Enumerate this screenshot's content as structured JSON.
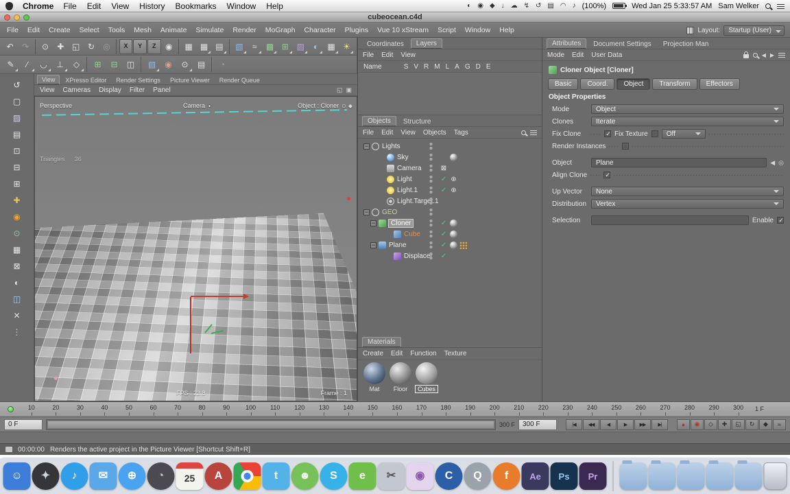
{
  "mac": {
    "app_name": "Chrome",
    "menus": [
      "File",
      "Edit",
      "View",
      "History",
      "Bookmarks",
      "Window",
      "Help"
    ],
    "status_icons": [
      {
        "name": "menu-extra-display-icon",
        "g": "◐"
      },
      {
        "name": "menu-extra-capture-icon",
        "g": "◉"
      },
      {
        "name": "menu-extra-dropbox-icon",
        "g": "◆"
      },
      {
        "name": "menu-extra-download-icon",
        "g": "↓"
      },
      {
        "name": "menu-extra-cloud-icon",
        "g": "☁"
      },
      {
        "name": "menu-extra-power-icon",
        "g": "↯"
      },
      {
        "name": "menu-extra-timemachine-icon",
        "g": "↺"
      },
      {
        "name": "menu-extra-airplay-icon",
        "g": "▤"
      },
      {
        "name": "menu-extra-wifi-icon",
        "g": "◠"
      },
      {
        "name": "menu-extra-volume-icon",
        "g": "♪"
      }
    ],
    "battery_pct": "(100%)",
    "clock": "Wed Jan 25  5:33:57 AM",
    "user": "Sam Welker"
  },
  "window_title": "cubeocean.c4d",
  "menu": {
    "items": [
      "File",
      "Edit",
      "Create",
      "Select",
      "Tools",
      "Mesh",
      "Animate",
      "Simulate",
      "Render",
      "MoGraph",
      "Character",
      "Plugins",
      "Vue 10 xStream",
      "Script",
      "Window",
      "Help"
    ],
    "layout_label": "Layout:",
    "layout_value": "Startup (User)"
  },
  "toolbar1": [
    {
      "name": "undo-icon",
      "g": "↶"
    },
    {
      "name": "redo-icon",
      "g": "↷",
      "cls": "dim"
    },
    {
      "name": "toolbar-separator",
      "cls": "sep",
      "inter": false
    },
    {
      "name": "live-selection-icon",
      "g": "⊙"
    },
    {
      "name": "move-tool-icon",
      "g": "✚"
    },
    {
      "name": "scale-tool-icon",
      "g": "◱"
    },
    {
      "name": "rotate-tool-icon",
      "g": "↻"
    },
    {
      "name": "last-tool-icon",
      "g": "◎",
      "cls": "dim"
    },
    {
      "name": "toolbar-separator",
      "cls": "sep",
      "inter": false
    },
    {
      "name": "lock-x-axis-button",
      "g": "X",
      "cls": "axis"
    },
    {
      "name": "lock-y-axis-button",
      "g": "Y",
      "cls": "axis"
    },
    {
      "name": "lock-z-axis-button",
      "g": "Z",
      "cls": "axis"
    },
    {
      "name": "coordinate-system-icon",
      "g": "◉"
    },
    {
      "name": "toolbar-separator",
      "cls": "sep",
      "inter": false
    },
    {
      "name": "render-active-view-icon",
      "g": "▦"
    },
    {
      "name": "render-picture-viewer-icon",
      "g": "▦",
      "cls": "arr"
    },
    {
      "name": "render-settings-icon",
      "g": "▤",
      "cls": "arr"
    },
    {
      "name": "toolbar-separator",
      "cls": "sep",
      "inter": false
    },
    {
      "name": "primitive-cube-icon",
      "g": "▧",
      "c": "#8db8e8",
      "cls": "arr"
    },
    {
      "name": "spline-pen-icon",
      "g": "≈",
      "cls": "arr"
    },
    {
      "name": "generators-icon",
      "g": "▩",
      "c": "#8fd08f",
      "cls": "arr"
    },
    {
      "name": "mograph-array-icon",
      "g": "⊞",
      "c": "#8fd08f",
      "cls": "arr"
    },
    {
      "name": "deformers-icon",
      "g": "▨",
      "c": "#bb9ddb",
      "cls": "arr"
    },
    {
      "name": "environment-icon",
      "g": "◐",
      "c": "#9ecbf0",
      "cls": "arr"
    },
    {
      "name": "camera-add-icon",
      "g": "▦",
      "cls": "arr"
    },
    {
      "name": "light-add-icon",
      "g": "☀",
      "c": "#f2df7a",
      "cls": "arr"
    }
  ],
  "toolbar2": [
    {
      "name": "brush-tool-icon",
      "g": "✎",
      "cls": "arr"
    },
    {
      "name": "knife-tool-icon",
      "g": "∕",
      "cls": "arr"
    },
    {
      "name": "magnet-tool-icon",
      "g": "◡",
      "cls": "arr"
    },
    {
      "name": "extrude-tool-icon",
      "g": "⊥",
      "cls": "arr"
    },
    {
      "name": "bevel-tool-icon",
      "g": "◇",
      "cls": "arr"
    },
    {
      "name": "toolbar-separator",
      "cls": "sep",
      "inter": false
    },
    {
      "name": "subdivide-icon",
      "g": "⊞",
      "c": "#8fd08f"
    },
    {
      "name": "optimize-icon",
      "g": "⊟",
      "c": "#8fd08f"
    },
    {
      "name": "mirror-icon",
      "g": "◫"
    },
    {
      "name": "toolbar-separator",
      "cls": "sep",
      "inter": false
    },
    {
      "name": "add-cube-icon",
      "g": "▧",
      "c": "#8db8e8",
      "cls": "arr"
    },
    {
      "name": "add-material-icon",
      "g": "◉",
      "c": "#e09a8a"
    },
    {
      "name": "snap-settings-icon",
      "g": "⊙",
      "cls": "arr"
    },
    {
      "name": "workplane-icon",
      "g": "▤"
    },
    {
      "name": "toolbar-separator",
      "cls": "sep",
      "inter": false
    },
    {
      "name": "isoline-editing-icon",
      "g": "◔",
      "cls": "dim"
    }
  ],
  "left_tools": [
    {
      "name": "make-editable-icon",
      "g": "↺",
      "c": "#e8e8e8"
    },
    {
      "name": "model-mode-icon",
      "g": "▢",
      "c": "#e8e8e8"
    },
    {
      "name": "texture-mode-icon",
      "g": "▨",
      "c": "#cfcfe8"
    },
    {
      "name": "workplane-mode-icon",
      "g": "▤",
      "c": "#e8e8e8"
    },
    {
      "name": "points-mode-icon",
      "g": "⊡",
      "c": "#e8e8e8"
    },
    {
      "name": "edges-mode-icon",
      "g": "⊟",
      "c": "#e8e8e8"
    },
    {
      "name": "polygons-mode-icon",
      "g": "⊞",
      "c": "#e8e8e8"
    },
    {
      "name": "enable-axis-icon",
      "g": "✚",
      "c": "#e8c85a"
    },
    {
      "name": "viewport-solo-icon",
      "g": "◉",
      "c": "#e8a33c"
    },
    {
      "name": "snap-toggle-icon",
      "g": "⊙",
      "c": "#8fd08f"
    },
    {
      "name": "quantize-icon",
      "g": "▦",
      "c": "#e8e8e8"
    },
    {
      "name": "lock-workplane-icon",
      "g": "⊠",
      "c": "#e8e8e8"
    },
    {
      "name": "xray-toggle-icon",
      "g": "◐",
      "c": "#e8e8e8"
    },
    {
      "name": "isoline-icon",
      "g": "◫",
      "c": "#9ecbf0"
    },
    {
      "name": "close-tool-icon",
      "g": "✕",
      "c": "#e0e0e0"
    },
    {
      "name": "palette-handle-icon",
      "g": "⋮",
      "c": "#cfcfcf"
    }
  ],
  "viewport": {
    "window_tabs": [
      {
        "label": "View",
        "cls": "on"
      },
      {
        "label": "XPresso Editor"
      },
      {
        "label": "Render Settings"
      },
      {
        "label": "Picture Viewer"
      },
      {
        "label": "Render Queue"
      }
    ],
    "menus": [
      "View",
      "Cameras",
      "Display",
      "Filter",
      "Panel"
    ],
    "corner_icons": [
      {
        "name": "viewport-undock-icon",
        "g": "◱"
      },
      {
        "name": "viewport-maximize-icon",
        "g": "▣"
      }
    ],
    "view_label": "Perspective",
    "camera_label": "Camera",
    "object_label": "Object : Cloner",
    "object_icons": [
      {
        "name": "viewport-lock-icon",
        "g": "⊙"
      },
      {
        "name": "viewport-key-icon",
        "g": "◆"
      }
    ],
    "hud_label": "Triangles",
    "hud_value": "36",
    "fps": "FPS : 23.8",
    "frame": "Frame : 1"
  },
  "layers_panel": {
    "tabs": [
      {
        "label": "Coordinates"
      },
      {
        "label": "Layers",
        "cls": "on"
      }
    ],
    "menus": [
      "File",
      "Edit",
      "View"
    ],
    "name_label": "Name",
    "columns": [
      "S",
      "V",
      "R",
      "M",
      "L",
      "A",
      "G",
      "D",
      "E"
    ]
  },
  "objects": {
    "tabs": [
      {
        "label": "Objects",
        "cls": "on"
      },
      {
        "label": "Structure"
      }
    ],
    "menus": [
      "File",
      "Edit",
      "View",
      "Objects",
      "Tags"
    ],
    "rows": [
      {
        "pad": "4px",
        "exp": "−",
        "icl": "ic-null",
        "iname": "null-object-icon",
        "name": "Lights"
      },
      {
        "pad": "26px",
        "icl": "ic-sky",
        "iname": "sky-object-icon",
        "name": "Sky",
        "t1": "tag-texture"
      },
      {
        "pad": "26px",
        "icl": "ic-camera",
        "iname": "camera-object-icon",
        "name": "Camera",
        "chk": "⊠",
        "chkcls": "wht"
      },
      {
        "pad": "26px",
        "icl": "ic-light",
        "iname": "light-object-icon",
        "name": "Light",
        "chk": "✓",
        "t1": "tag-target"
      },
      {
        "pad": "26px",
        "icl": "ic-light",
        "iname": "light-object-icon",
        "name": "Light.1",
        "chk": "✓",
        "t1": "tag-target"
      },
      {
        "pad": "26px",
        "icl": "ic-target",
        "iname": "light-target-icon",
        "name": "Light.Target.1"
      },
      {
        "pad": "4px",
        "exp": "−",
        "icl": "ic-null",
        "iname": "null-object-icon",
        "name": "GEO",
        "ncls": "geo"
      },
      {
        "pad": "14px",
        "exp": "−",
        "icl": "ic-cloner",
        "iname": "cloner-object-icon",
        "name": "Cloner",
        "ncls": "selname",
        "chk": "✓",
        "t1": "tag-texture"
      },
      {
        "pad": "36px",
        "icl": "ic-cube",
        "iname": "cube-object-icon",
        "name": "Cube",
        "ncls": "consumed",
        "chk": "✓",
        "t1": "tag-texture"
      },
      {
        "pad": "14px",
        "exp": "−",
        "icl": "ic-plane",
        "iname": "plane-object-icon",
        "name": "Plane",
        "chk": "✓",
        "t1": "tag-texture",
        "t2": "tag-dots"
      },
      {
        "pad": "36px",
        "icl": "ic-displacer",
        "iname": "displacer-object-icon",
        "name": "Displacer",
        "chk": "✓"
      }
    ]
  },
  "materials": {
    "tab": "Materials",
    "menus": [
      "Create",
      "Edit",
      "Function",
      "Texture"
    ],
    "items": [
      {
        "name": "Mat",
        "cls": "m1"
      },
      {
        "name": "Floor",
        "cls": "m2"
      },
      {
        "name": "Cubes",
        "cls": "m3",
        "sel": "sel"
      }
    ]
  },
  "attributes": {
    "tabs": [
      {
        "label": "Attributes",
        "cls": "on"
      },
      {
        "label": "Document Settings"
      },
      {
        "label": "Projection Man"
      }
    ],
    "menus": [
      "Mode",
      "Edit",
      "User Data"
    ],
    "title": "Cloner Object [Cloner]",
    "buttons": [
      {
        "label": "Basic"
      },
      {
        "label": "Coord."
      },
      {
        "label": "Object",
        "cls": "on"
      },
      {
        "label": "Transform"
      },
      {
        "label": "Effectors"
      }
    ],
    "section": "Object Properties",
    "mode_label": "Mode",
    "mode_value": "Object",
    "clones_label": "Clones",
    "clones_value": "Iterate",
    "fix_clone_label": "Fix Clone",
    "fix_texture_label": "Fix Texture",
    "fix_texture_value": "Off",
    "render_instances_label": "Render Instances",
    "object_label": "Object",
    "object_value": "Plane",
    "align_clone_label": "Align Clone",
    "up_vector_label": "Up Vector",
    "up_vector_value": "None",
    "distribution_label": "Distribution",
    "distribution_value": "Vertex",
    "selection_label": "Selection",
    "enable_label": "Enable"
  },
  "timeline": {
    "ticks": [
      "10",
      "20",
      "30",
      "40",
      "50",
      "60",
      "70",
      "80",
      "90",
      "100",
      "110",
      "120",
      "130",
      "140",
      "150",
      "160",
      "170",
      "180",
      "190",
      "200",
      "210",
      "220",
      "230",
      "240",
      "250",
      "260",
      "270",
      "280",
      "290",
      "300"
    ],
    "right_label": "1 F"
  },
  "transport": {
    "start_field": "0 F",
    "range_label": "300 F",
    "end_field": "300 F",
    "buttons": [
      {
        "name": "goto-start-button",
        "g": "|◀"
      },
      {
        "name": "prev-key-button",
        "g": "◀◀"
      },
      {
        "name": "prev-frame-button",
        "g": "◀"
      },
      {
        "name": "play-button",
        "g": "▶"
      },
      {
        "name": "next-key-button",
        "g": "▶▶"
      },
      {
        "name": "goto-end-button",
        "g": "▶|"
      }
    ],
    "record": [
      {
        "name": "record-keyframe-button",
        "g": "●",
        "cls": "red"
      },
      {
        "name": "autokeying-button",
        "g": "◉",
        "cls": "red"
      },
      {
        "name": "keyframe-selection-button",
        "g": "◇"
      },
      {
        "name": "record-position-toggle",
        "g": "✚"
      },
      {
        "name": "record-scale-toggle",
        "g": "◱"
      },
      {
        "name": "record-rotation-toggle",
        "g": "↻"
      },
      {
        "name": "record-parameter-toggle",
        "g": "◆"
      },
      {
        "name": "record-pla-toggle",
        "g": "≈"
      }
    ]
  },
  "status": {
    "time": "00:00:00",
    "message": "Renders the active project in the Picture Viewer [Shortcut Shift+R]"
  },
  "dock": {
    "items": [
      {
        "name": "dock-finder-icon",
        "g": "☺",
        "cls": "",
        "bg": "#3d7edb",
        "fg": "#fff"
      },
      {
        "name": "dock-launchpad-icon",
        "g": "✦",
        "cls": "round",
        "bg": "#35353a",
        "fg": "#cfd4dc"
      },
      {
        "name": "dock-itunes-icon",
        "g": "♪",
        "cls": "round",
        "bg": "#2e9fe8",
        "fg": "#fff"
      },
      {
        "name": "dock-mail-icon",
        "g": "✉",
        "cls": "",
        "bg": "#5aa8e8",
        "fg": "#fff"
      },
      {
        "name": "dock-safari-icon",
        "g": "⊕",
        "cls": "round",
        "bg": "#4aa3f0",
        "fg": "#fff"
      },
      {
        "name": "dock-dashboard-icon",
        "g": "◔",
        "cls": "round",
        "bg": "#4a4a50",
        "fg": "#ccc"
      },
      {
        "name": "dock-calendar-icon",
        "g": "25",
        "cls": "cal",
        "bg": "#f4f4ee",
        "fg": "#333"
      },
      {
        "name": "dock-appstore-icon",
        "g": "A",
        "cls": "round",
        "bg": "#b8453c",
        "fg": "#fff"
      },
      {
        "name": "dock-chrome-icon",
        "g": "",
        "cls": "chrome"
      },
      {
        "name": "dock-twitter-icon",
        "g": "t",
        "cls": "",
        "bg": "#53b3e8",
        "fg": "#fff"
      },
      {
        "name": "dock-android-icon",
        "g": "☻",
        "cls": "round",
        "bg": "#77c159",
        "fg": "#fff"
      },
      {
        "name": "dock-skype-icon",
        "g": "S",
        "cls": "round",
        "bg": "#36b2e8",
        "fg": "#fff"
      },
      {
        "name": "dock-evernote-icon",
        "g": "e",
        "cls": "",
        "bg": "#6fbf4a",
        "fg": "#fff"
      },
      {
        "name": "dock-preview-icon",
        "g": "✂",
        "cls": "",
        "bg": "#c2c8d0",
        "fg": "#555"
      },
      {
        "name": "dock-photobooth-icon",
        "g": "◉",
        "cls": "",
        "bg": "#e4d4ee",
        "fg": "#8a5aa8"
      },
      {
        "name": "dock-cinema4d-icon",
        "g": "C",
        "cls": "round",
        "bg": "#2b5fa8",
        "fg": "#fff"
      },
      {
        "name": "dock-quicktime-icon",
        "g": "Q",
        "cls": "round",
        "bg": "#9aa2ac",
        "fg": "#fff"
      },
      {
        "name": "dock-firefox-icon",
        "g": "f",
        "cls": "round",
        "bg": "#e87c2a",
        "fg": "#fff"
      },
      {
        "name": "dock-after-effects-icon",
        "g": "Ae",
        "cls": "adobe",
        "bg": "#3a3a5e",
        "fg": "#b9a6e8"
      },
      {
        "name": "dock-photoshop-icon",
        "g": "Ps",
        "cls": "adobe",
        "bg": "#15324e",
        "fg": "#9cc8f0"
      },
      {
        "name": "dock-premiere-icon",
        "g": "Pr",
        "cls": "adobe",
        "bg": "#3a2a52",
        "fg": "#c8a6e8"
      },
      {
        "name": "dock-divider",
        "cls": "dkdiv",
        "inter": false
      },
      {
        "name": "dock-documents-folder",
        "cls": "folder"
      },
      {
        "name": "dock-applications-folder",
        "cls": "folder"
      },
      {
        "name": "dock-utilities-folder",
        "cls": "folder"
      },
      {
        "name": "dock-downloads-folder",
        "cls": "folder"
      },
      {
        "name": "dock-movies-folder",
        "cls": "folder"
      },
      {
        "name": "dock-trash-icon",
        "cls": "trash"
      }
    ]
  }
}
